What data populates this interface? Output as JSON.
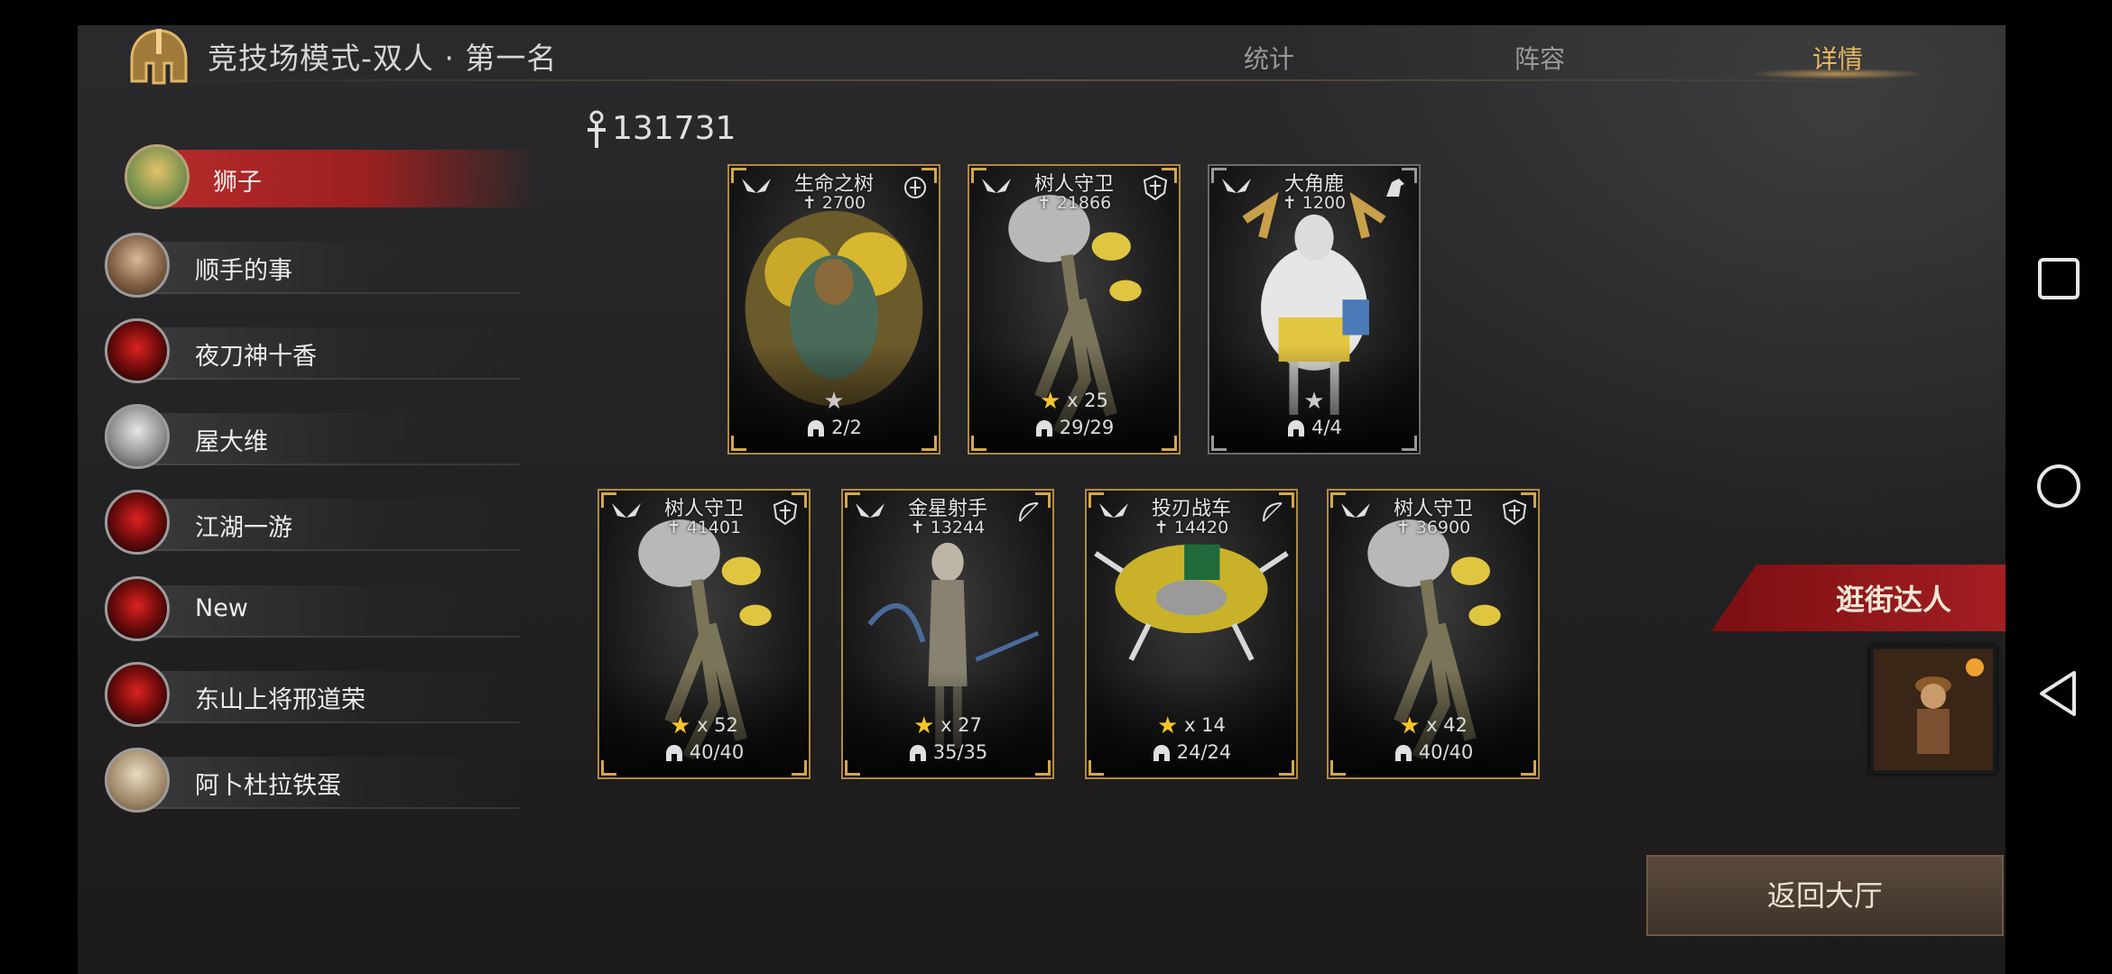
{
  "header": {
    "mode_title": "竞技场模式-双人 · 第一名",
    "tabs": [
      {
        "label": "统计",
        "active": false
      },
      {
        "label": "阵容",
        "active": false
      },
      {
        "label": "详情",
        "active": true
      }
    ]
  },
  "players": [
    {
      "name": "狮子",
      "selected": true
    },
    {
      "name": "顺手的事",
      "selected": false
    },
    {
      "name": "夜刀神十香",
      "selected": false
    },
    {
      "name": "屋大维",
      "selected": false
    },
    {
      "name": "江湖一游",
      "selected": false
    },
    {
      "name": "New",
      "selected": false
    },
    {
      "name": "东山上将邢道荣",
      "selected": false
    },
    {
      "name": "阿卜杜拉铁蛋",
      "selected": false
    }
  ],
  "total_power": "131731",
  "cards_row1": [
    {
      "name": "生命之树",
      "power": "2700",
      "stars": "",
      "count": "2/2",
      "class_icon": "nature-icon"
    },
    {
      "name": "树人守卫",
      "power": "21866",
      "stars": "x 25",
      "count": "29/29",
      "class_icon": "shield-icon"
    },
    {
      "name": "大角鹿",
      "power": "1200",
      "stars": "",
      "count": "4/4",
      "class_icon": "horse-icon"
    }
  ],
  "cards_row2": [
    {
      "name": "树人守卫",
      "power": "41401",
      "stars": "x 52",
      "count": "40/40",
      "class_icon": "shield-icon"
    },
    {
      "name": "金星射手",
      "power": "13244",
      "stars": "x 27",
      "count": "35/35",
      "class_icon": "bow-icon"
    },
    {
      "name": "投刃战车",
      "power": "14420",
      "stars": "x 14",
      "count": "24/24",
      "class_icon": "bow-icon"
    },
    {
      "name": "树人守卫",
      "power": "36900",
      "stars": "x 42",
      "count": "40/40",
      "class_icon": "shield-icon"
    }
  ],
  "achievement": {
    "title": "逛街达人"
  },
  "back_button": "返回大厅",
  "colors": {
    "accent_gold": "#e4b860",
    "selected_red": "#b52a2a",
    "card_border_gold": "#b08a3e",
    "star_gold": "#f6c52c"
  }
}
